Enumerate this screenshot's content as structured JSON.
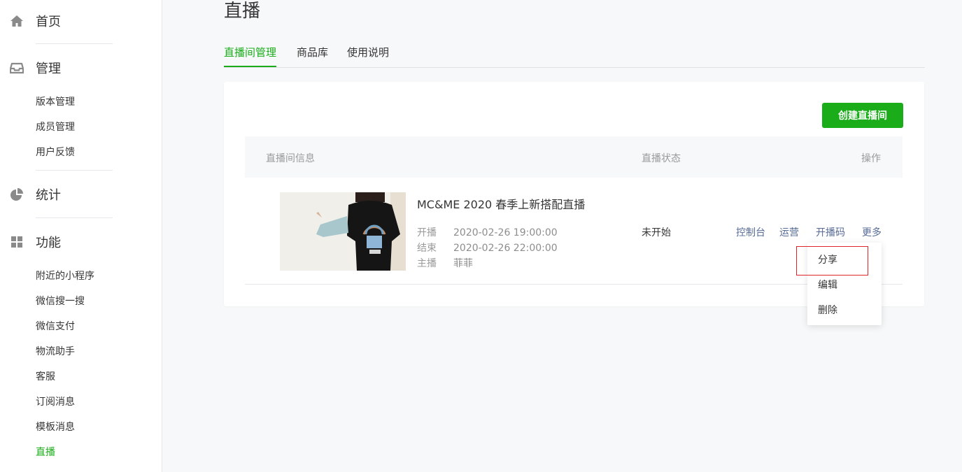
{
  "sidebar": {
    "home": {
      "label": "首页",
      "icon": "home-icon"
    },
    "manage": {
      "label": "管理",
      "icon": "inbox-icon",
      "items": [
        "版本管理",
        "成员管理",
        "用户反馈"
      ]
    },
    "stats": {
      "label": "统计",
      "icon": "pie-chart-icon"
    },
    "features": {
      "label": "功能",
      "icon": "grid-icon",
      "items": [
        "附近的小程序",
        "微信搜一搜",
        "微信支付",
        "物流助手",
        "客服",
        "订阅消息",
        "模板消息",
        "直播"
      ],
      "active_index": 7
    }
  },
  "page": {
    "title": "直播"
  },
  "tabs": [
    "直播间管理",
    "商品库",
    "使用说明"
  ],
  "card": {
    "create_button": "创建直播间",
    "headers": {
      "info": "直播间信息",
      "status": "直播状态",
      "ops": "操作"
    },
    "row": {
      "title": "MC&ME 2020 春季上新搭配直播",
      "start_label": "开播",
      "start_value": "2020-02-26 19:00:00",
      "end_label": "结束",
      "end_value": "2020-02-26 22:00:00",
      "host_label": "主播",
      "host_value": "菲菲",
      "status": "未开始",
      "ops": [
        "控制台",
        "运营",
        "开播码",
        "更多"
      ]
    }
  },
  "dropdown": {
    "items": [
      "分享",
      "编辑",
      "删除"
    ]
  },
  "colors": {
    "accent": "#1aad19",
    "link": "#576b95",
    "highlight": "#e0252a"
  }
}
